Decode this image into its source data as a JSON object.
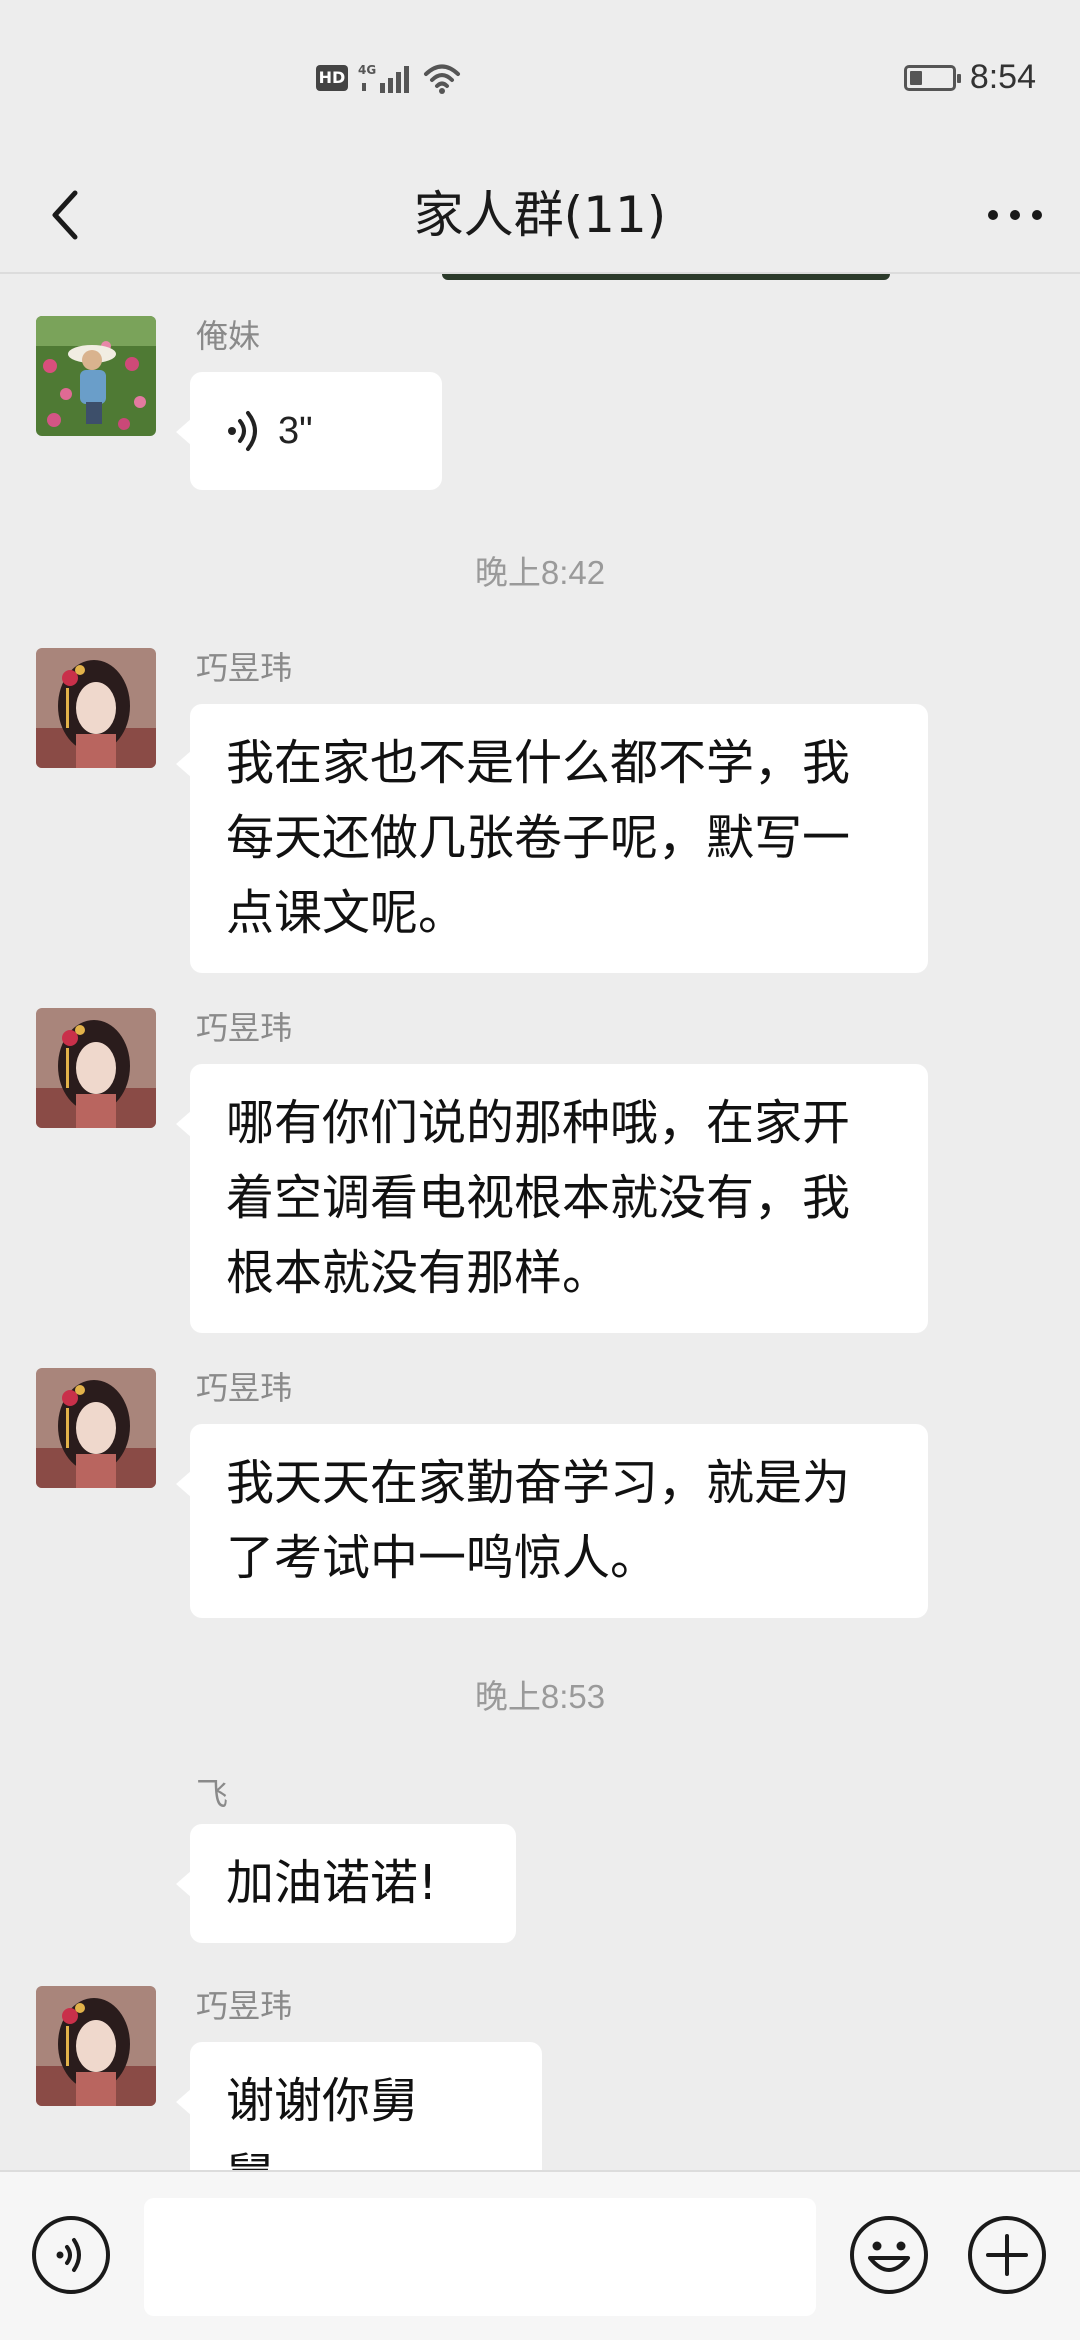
{
  "status_bar": {
    "hd_badge": "HD",
    "network_label": "4G",
    "time": "8:54",
    "icons": [
      "hd-icon",
      "signal-4g-icon",
      "wifi-icon",
      "battery-icon"
    ]
  },
  "nav": {
    "title": "家人群(11)",
    "back_icon": "chevron-left-icon",
    "more_icon": "more-dots-icon"
  },
  "messages": [
    {
      "sender": "俺妹",
      "type": "voice",
      "duration": "3\"",
      "avatar": "avatar-woman-in-flower-field"
    },
    {
      "type": "timestamp",
      "text": "晚上8:42"
    },
    {
      "sender": "巧昱玮",
      "type": "text",
      "text": "我在家也不是什么都不学，我每天还做几张卷子呢，默写一点课文呢。",
      "avatar": "avatar-girl-portrait"
    },
    {
      "sender": "巧昱玮",
      "type": "text",
      "text": "哪有你们说的那种哦，在家开着空调看电视根本就没有，我根本就没有那样。",
      "avatar": "avatar-girl-portrait"
    },
    {
      "sender": "巧昱玮",
      "type": "text",
      "text": "我天天在家勤奋学习，就是为了考试中一鸣惊人。",
      "avatar": "avatar-girl-portrait"
    },
    {
      "type": "timestamp",
      "text": "晚上8:53"
    },
    {
      "sender": "飞",
      "type": "text",
      "text": "加油诺诺!",
      "avatar": "none"
    },
    {
      "sender": "巧昱玮",
      "type": "text",
      "text": "谢谢你舅舅。",
      "avatar": "avatar-girl-portrait"
    }
  ],
  "input_bar": {
    "placeholder": "",
    "voice_icon": "voice-mode-icon",
    "emoji_icon": "emoji-icon",
    "plus_icon": "plus-icon"
  },
  "colors": {
    "background": "#ededed",
    "bubble": "#ffffff",
    "name_text": "#8a8a8a",
    "timestamp_text": "#9a9a9a"
  }
}
